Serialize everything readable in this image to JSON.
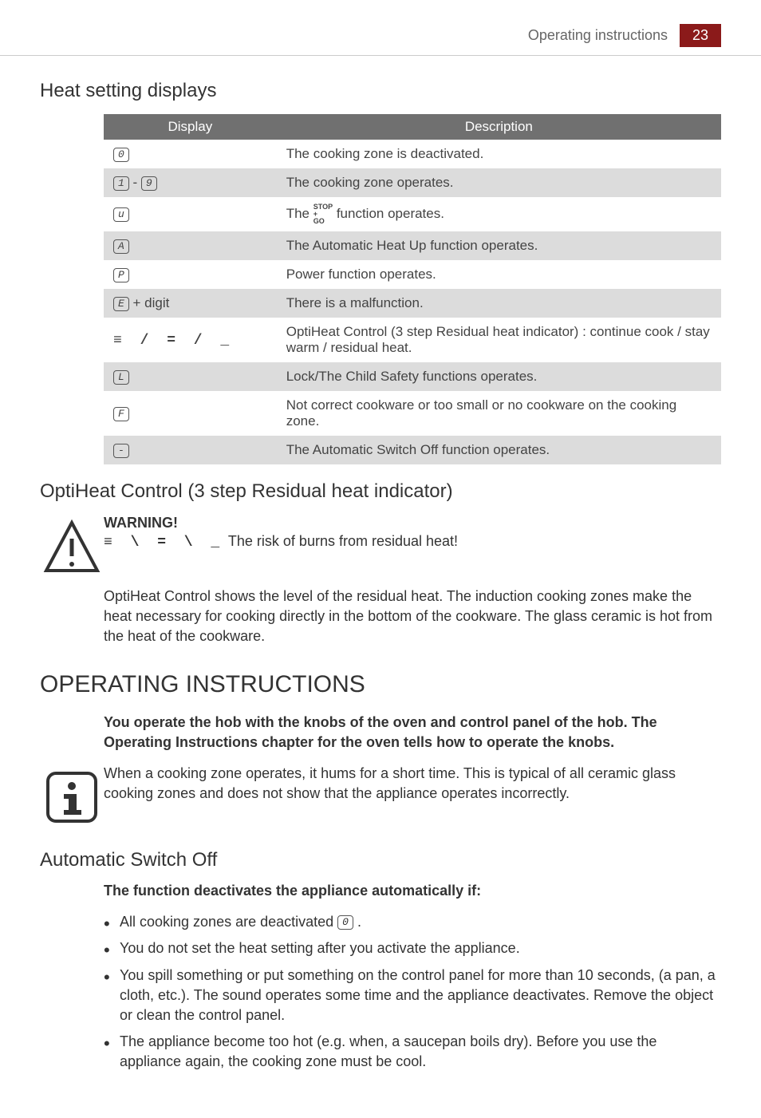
{
  "header": {
    "title": "Operating instructions",
    "page": "23"
  },
  "heat_setting": {
    "heading": "Heat setting displays",
    "table": {
      "col1": "Display",
      "col2": "Description",
      "rows": [
        {
          "display": "0",
          "desc": "The cooking zone is deactivated."
        },
        {
          "display_range": [
            "1",
            "9"
          ],
          "desc": "The cooking zone operates."
        },
        {
          "display": "u",
          "desc_pre": "The ",
          "desc_post": " function operates.",
          "stopgo": true
        },
        {
          "display": "A",
          "desc": "The Automatic Heat Up function operates."
        },
        {
          "display": "P",
          "desc": "Power function operates."
        },
        {
          "display": "E",
          "display_suffix": " + digit",
          "desc": "There is a malfunction."
        },
        {
          "display_residual": true,
          "desc": "OptiHeat Control (3 step Residual heat indicator) : continue cook / stay warm / residual heat."
        },
        {
          "display": "L",
          "desc": "Lock/The Child Safety functions operates."
        },
        {
          "display": "F",
          "desc": "Not correct cookware or too small or no cookware on the cooking zone."
        },
        {
          "display": "-",
          "desc": "The Automatic Switch Off function operates."
        }
      ]
    }
  },
  "optiheat": {
    "heading": "OptiHeat Control (3 step Residual heat indicator)",
    "warning_title": "WARNING!",
    "warning_text": " The risk of burns from residual heat!",
    "body": "OptiHeat Control shows the level of the residual heat. The induction cooking zones make the heat necessary for cooking directly in the bottom of the cookware. The glass ceramic is hot from the heat of the cookware."
  },
  "operating": {
    "heading": "OPERATING INSTRUCTIONS",
    "intro": "You operate the hob with the knobs of the oven and control panel of the hob. The Operating Instructions chapter for the oven tells how to operate the knobs.",
    "info": "When a cooking zone operates, it hums for a short time. This is typical of all ceramic glass cooking zones and does not show that the appliance operates incorrectly."
  },
  "auto_off": {
    "heading": "Automatic Switch Off",
    "subheading": "The function deactivates the appliance automatically if:",
    "items": [
      "All cooking zones are deactivated ",
      "You do not set the heat setting after you activate the appliance.",
      "You spill something or put something on the control panel for more than 10 seconds, (a pan, a cloth, etc.). The sound operates some time and the appliance deactivates. Remove the object or clean the control panel.",
      "The appliance become too hot (e.g. when, a saucepan boils dry). Before you use the appliance again, the cooking zone must be cool."
    ]
  }
}
